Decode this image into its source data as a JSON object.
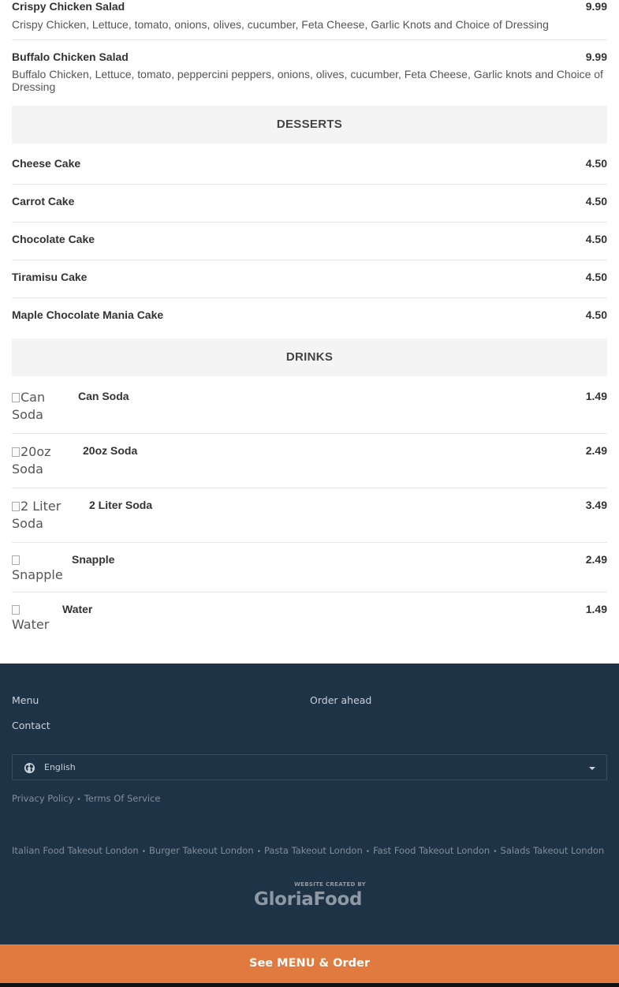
{
  "salads": [
    {
      "name": "Crispy Chicken Salad",
      "price": "9.99",
      "desc": "Crispy Chicken, Lettuce, tomato, onions, olives, cucumber, Feta Cheese, Garlic Knots and Choice of Dressing"
    },
    {
      "name": "Buffalo Chicken Salad",
      "price": "9.99",
      "desc": "Buffalo Chicken, Lettuce, tomato, peppercini peppers, onions, olives, cucumber, Feta Cheese, Garlic knots and Choice of Dressing"
    }
  ],
  "desserts": {
    "title": "DESSERTS",
    "items": [
      {
        "name": "Cheese Cake",
        "price": "4.50"
      },
      {
        "name": "Carrot Cake",
        "price": "4.50"
      },
      {
        "name": "Chocolate Cake",
        "price": "4.50"
      },
      {
        "name": "Tiramisu Cake",
        "price": "4.50"
      },
      {
        "name": "Maple Chocolate Mania Cake",
        "price": "4.50"
      }
    ]
  },
  "drinks": {
    "title": "DRINKS",
    "items": [
      {
        "img_alt_1": "Can",
        "img_alt_2": "Soda",
        "name": "Can Soda",
        "price": "1.49"
      },
      {
        "img_alt_1": "20oz",
        "img_alt_2": "Soda",
        "name": "20oz Soda",
        "price": "2.49"
      },
      {
        "img_alt_1": "2 Liter",
        "img_alt_2": "Soda",
        "name": "2 Liter Soda",
        "price": "3.49"
      },
      {
        "img_alt_1": "",
        "img_alt_2": "Snapple",
        "name": "Snapple",
        "price": "2.49"
      },
      {
        "img_alt_1": "",
        "img_alt_2": "Water",
        "name": "Water",
        "price": "1.49"
      }
    ]
  },
  "footer": {
    "menu_link": "Menu",
    "order_ahead_link": "Order ahead",
    "contact_link": "Contact",
    "language": "English",
    "privacy_link": "Privacy Policy",
    "terms_link": "Terms Of Service",
    "takeout_links": [
      "Italian Food Takeout London",
      "Burger Takeout London",
      "Pasta Takeout London",
      "Fast Food Takeout London",
      "Salads Takeout London"
    ],
    "logo_small": "WEBSITE CREATED BY",
    "logo_big": "GloriaFood"
  },
  "order_button": "See MENU & Order",
  "colors": {
    "footer_bg": "#1f3346",
    "order_bar": "#e07a3e",
    "section_bg": "#f4f4f4"
  }
}
